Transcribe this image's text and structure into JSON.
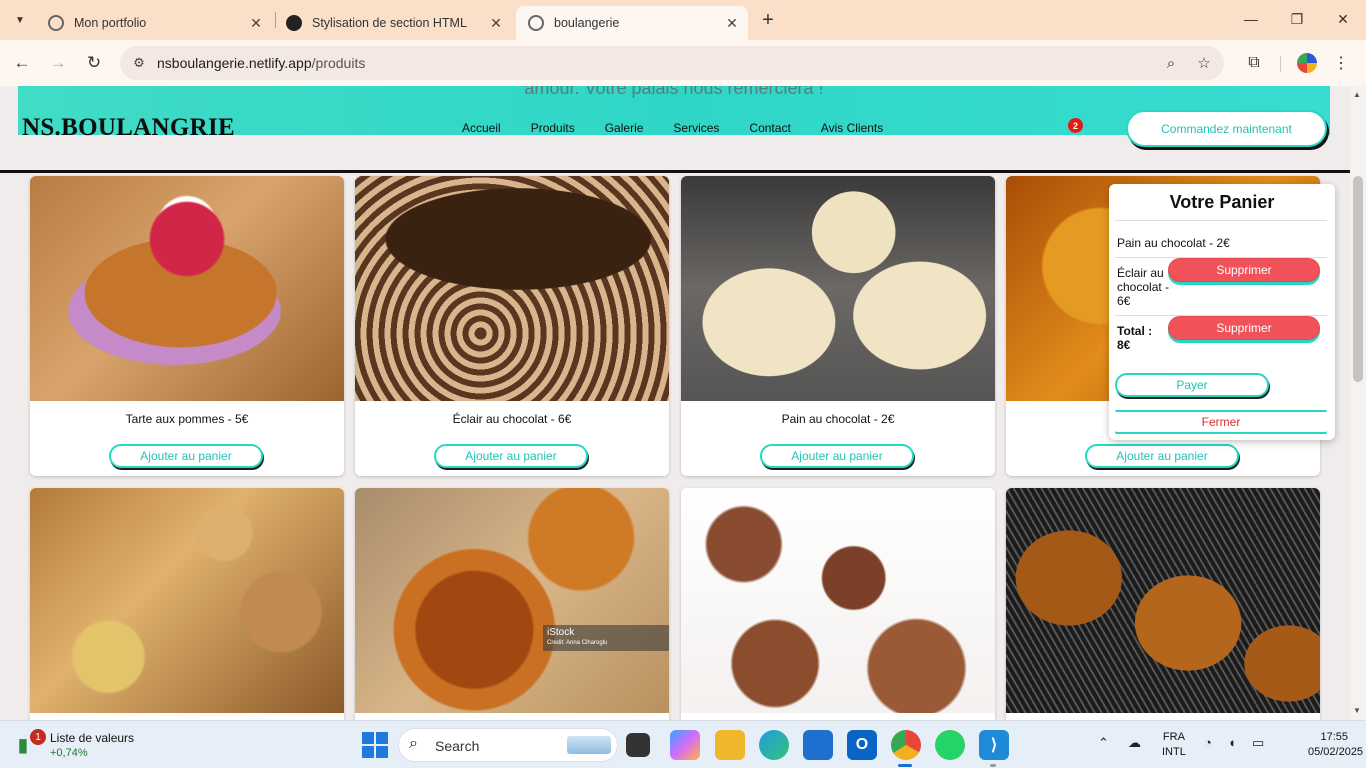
{
  "browser": {
    "tabs": [
      {
        "title": "Mon portfolio",
        "active": false
      },
      {
        "title": "Stylisation de section HTML",
        "active": false
      },
      {
        "title": "boulangerie",
        "active": true
      }
    ],
    "url_host": "nsboulangerie.netlify.app",
    "url_path": "/produits"
  },
  "site": {
    "hero_text": "amour. Votre palais nous remerciera !",
    "logo": "NS.BOULANGRIE",
    "nav": [
      "Accueil",
      "Produits",
      "Galerie",
      "Services",
      "Contact",
      "Avis Clients"
    ],
    "cart_count": "2",
    "cta": "Commandez maintenant",
    "accent_color": "#2fd6c7"
  },
  "products": [
    {
      "name": "Tarte aux pommes - 5€",
      "button": "Ajouter au panier"
    },
    {
      "name": "Éclair au chocolat - 6€",
      "button": "Ajouter au panier"
    },
    {
      "name": "Pain au chocolat - 2€",
      "button": "Ajouter au panier"
    },
    {
      "name": "",
      "button": "Ajouter au panier"
    },
    {
      "name": "",
      "button": ""
    },
    {
      "name": "",
      "button": "",
      "overlay_title": "iStock",
      "overlay_credit": "Credit: Anna Ciharoglu"
    },
    {
      "name": "",
      "button": ""
    },
    {
      "name": "",
      "button": ""
    }
  ],
  "cart": {
    "title": "Votre Panier",
    "items": [
      {
        "label": "Pain au chocolat - 2€"
      },
      {
        "label": "Éclair au chocolat - 6€"
      }
    ],
    "delete_label": "Supprimer",
    "total_label": "Total : 8€",
    "pay": "Payer",
    "close": "Fermer",
    "delete_color": "#f15259"
  },
  "taskbar": {
    "widget_title": "Liste de valeurs",
    "widget_value": "+0,74%",
    "widget_badge": "1",
    "search": "Search",
    "lang1": "FRA",
    "lang2": "INTL",
    "time": "17:55",
    "date": "05/02/2025"
  }
}
